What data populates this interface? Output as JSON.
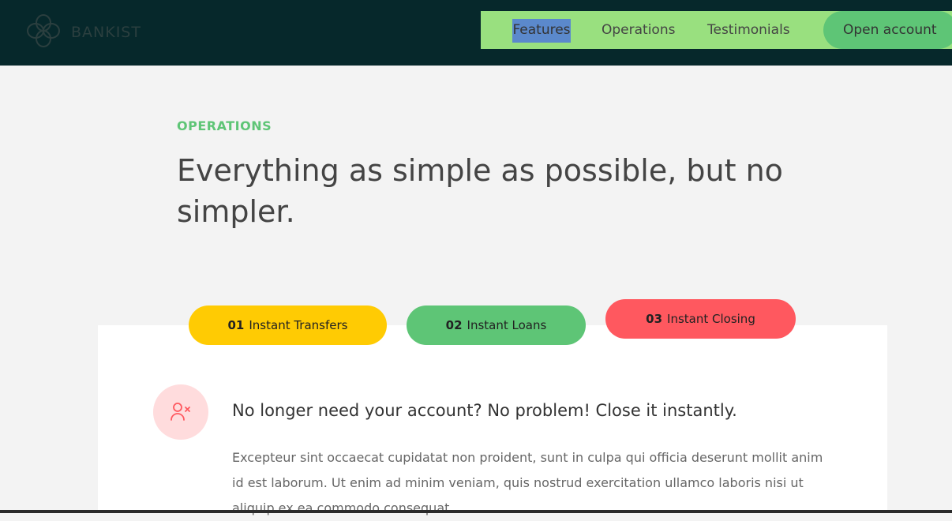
{
  "header": {
    "logo_text": "BANKIST",
    "logo_icon": "bankist-logo-icon",
    "colors": {
      "background": "#06282b",
      "nav_background": "#99e07f",
      "accent": "#5ec576"
    }
  },
  "nav": {
    "links": [
      {
        "label": "Features",
        "selected": true
      },
      {
        "label": "Operations"
      },
      {
        "label": "Testimonials"
      }
    ],
    "cta_label": "Open account"
  },
  "section": {
    "label": "OPERATIONS",
    "title": "Everything as simple as possible, but no simpler."
  },
  "tabs": [
    {
      "number": "01",
      "label": "Instant Transfers",
      "color": "#ffcb03"
    },
    {
      "number": "02",
      "label": "Instant Loans",
      "color": "#5ec576"
    },
    {
      "number": "03",
      "label": "Instant Closing",
      "color": "#ff585f",
      "active": true
    }
  ],
  "content": {
    "icon": "user-remove-icon",
    "title": "No longer need your account? No problem! Close it instantly.",
    "text": "Excepteur sint occaecat cupidatat non proident, sunt in culpa qui officia deserunt mollit anim id est laborum. Ut enim ad minim veniam, quis nostrud exercitation ullamco laboris nisi ut aliquip ex ea commodo consequat."
  }
}
